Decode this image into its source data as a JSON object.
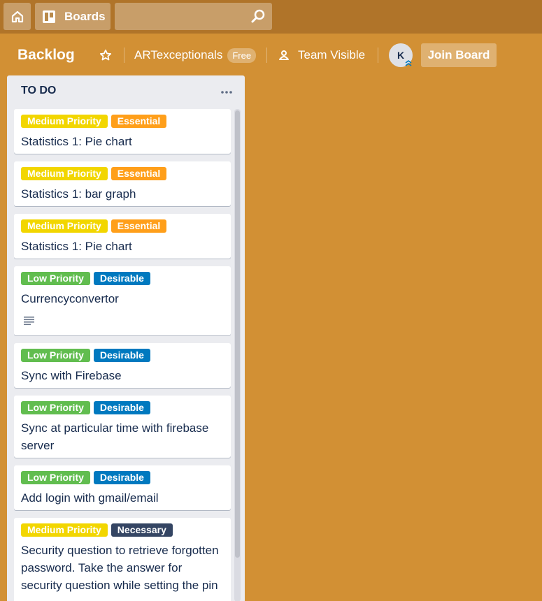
{
  "header": {
    "home_icon": "home-icon",
    "boards_label": "Boards",
    "boards_icon": "boards-icon",
    "search_placeholder": "",
    "search_icon": "magnifier-icon"
  },
  "board": {
    "title": "Backlog",
    "star_icon": "star-outline-icon",
    "team": "ARTexceptionals",
    "plan_badge": "Free",
    "visibility_label": "Team Visible",
    "visibility_icon": "team-icon",
    "member_initial": "K",
    "join_label": "Join Board"
  },
  "colors": {
    "board_bg": "#d29034",
    "header_bg": "#b07429",
    "yellow": "#f2d600",
    "orange": "#ff9f1a",
    "green": "#61bd4f",
    "blue": "#0079bf",
    "navy": "#344563"
  },
  "list": {
    "title": "TO DO",
    "menu_icon": "ellipsis-icon",
    "cards": [
      {
        "labels": [
          {
            "text": "Medium Priority",
            "color": "yellow"
          },
          {
            "text": "Essential",
            "color": "orange"
          }
        ],
        "title": "Statistics 1: Pie chart"
      },
      {
        "labels": [
          {
            "text": "Medium Priority",
            "color": "yellow"
          },
          {
            "text": "Essential",
            "color": "orange"
          }
        ],
        "title": "Statistics 1: bar graph"
      },
      {
        "labels": [
          {
            "text": "Medium Priority",
            "color": "yellow"
          },
          {
            "text": "Essential",
            "color": "orange"
          }
        ],
        "title": "Statistics 1: Pie chart"
      },
      {
        "labels": [
          {
            "text": "Low Priority",
            "color": "green"
          },
          {
            "text": "Desirable",
            "color": "blue"
          }
        ],
        "title": "Currencyconvertor",
        "has_description": true
      },
      {
        "labels": [
          {
            "text": "Low Priority",
            "color": "green"
          },
          {
            "text": "Desirable",
            "color": "blue"
          }
        ],
        "title": "Sync with Firebase"
      },
      {
        "labels": [
          {
            "text": "Low Priority",
            "color": "green"
          },
          {
            "text": "Desirable",
            "color": "blue"
          }
        ],
        "title": "Sync at particular time with firebase server"
      },
      {
        "labels": [
          {
            "text": "Low Priority",
            "color": "green"
          },
          {
            "text": "Desirable",
            "color": "blue"
          }
        ],
        "title": "Add login with gmail/email"
      },
      {
        "labels": [
          {
            "text": "Medium Priority",
            "color": "yellow"
          },
          {
            "text": "Necessary",
            "color": "navy"
          }
        ],
        "title": "Security question to retrieve forgotten password. Take the answer for security question while setting the pin"
      }
    ]
  }
}
